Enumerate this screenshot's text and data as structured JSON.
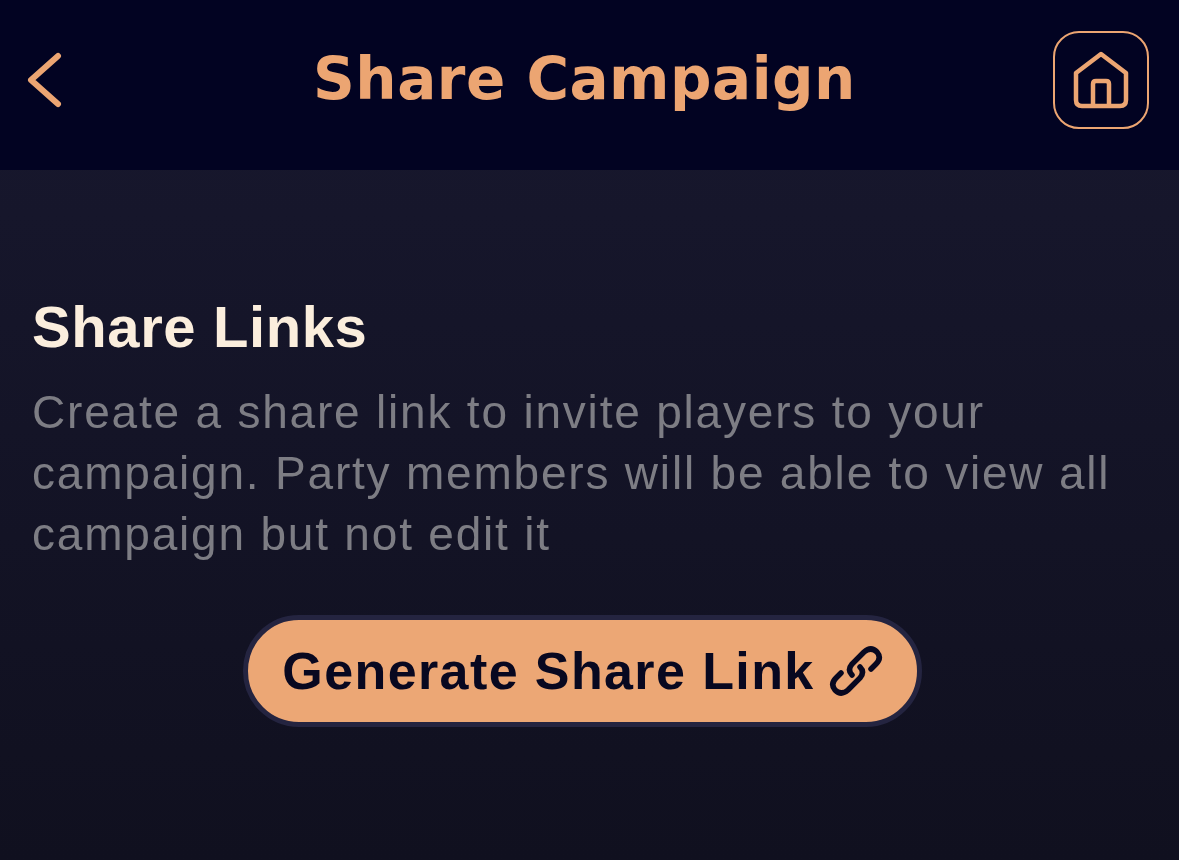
{
  "header": {
    "title": "Share Campaign"
  },
  "section": {
    "heading": "Share Links",
    "description": "Create a share link to invite players to your campaign. Party members will be able to view all campaign but not edit it"
  },
  "button": {
    "label": "Generate Share Link"
  }
}
